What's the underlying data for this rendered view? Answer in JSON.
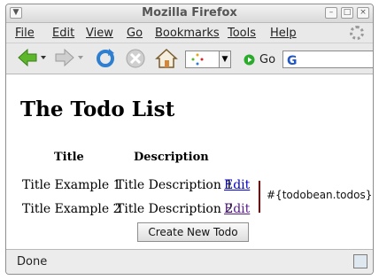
{
  "window": {
    "title": "Mozilla Firefox"
  },
  "menubar": {
    "file": "File",
    "edit": "Edit",
    "view": "View",
    "go": "Go",
    "bookmarks": "Bookmarks",
    "tools": "Tools",
    "help": "Help"
  },
  "toolbar": {
    "go_label": "Go"
  },
  "page": {
    "heading": "The Todo List",
    "columns": [
      "Title",
      "Description"
    ],
    "rows": [
      {
        "title": "Title Example 1",
        "description": "Title Description 1",
        "action": "Edit"
      },
      {
        "title": "Title Example 2",
        "description": "Title Description 2",
        "action": "Edit"
      }
    ],
    "expression_text": "#{todobean.todos}",
    "create_button": "Create New Todo"
  },
  "statusbar": {
    "text": "Done"
  },
  "colors": {
    "link": "#0000cc",
    "visited_link": "#551a8b",
    "divider": "#6b0000"
  },
  "icons": [
    "back-arrow-icon",
    "forward-arrow-icon",
    "reload-icon",
    "stop-icon",
    "home-icon",
    "throbber-icon",
    "go-icon",
    "google-search-icon",
    "security-icon"
  ]
}
